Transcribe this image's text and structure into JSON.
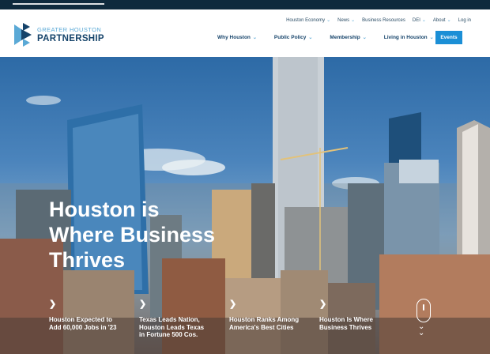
{
  "logo": {
    "line1": "GREATER HOUSTON",
    "line2": "PARTNERSHIP"
  },
  "utility_nav": [
    {
      "label": "Houston Economy",
      "dropdown": true
    },
    {
      "label": "News",
      "dropdown": true
    },
    {
      "label": "Business Resources",
      "dropdown": false
    },
    {
      "label": "DEI",
      "dropdown": true
    },
    {
      "label": "About",
      "dropdown": true
    },
    {
      "label": "Log in",
      "dropdown": false
    }
  ],
  "main_nav": [
    {
      "label": "Why Houston"
    },
    {
      "label": "Public Policy"
    },
    {
      "label": "Membership"
    },
    {
      "label": "Living in Houston"
    }
  ],
  "events_button": "Events",
  "hero": {
    "title_lines": [
      "Houston is",
      "Where Business",
      "Thrives"
    ]
  },
  "cards": [
    {
      "lines": [
        "Houston Expected to",
        "Add 60,000 Jobs in '23"
      ]
    },
    {
      "lines": [
        "Texas Leads Nation,",
        "Houston Leads Texas",
        "in Fortune 500 Cos."
      ]
    },
    {
      "lines": [
        "Houston Ranks Among",
        "America's Best Cities"
      ]
    },
    {
      "lines": [
        "Houston Is Where",
        "Business Thrives"
      ]
    }
  ],
  "colors": {
    "brand_navy": "#15436a",
    "brand_blue": "#1b8fd6",
    "topbar": "#0e2a3d"
  }
}
